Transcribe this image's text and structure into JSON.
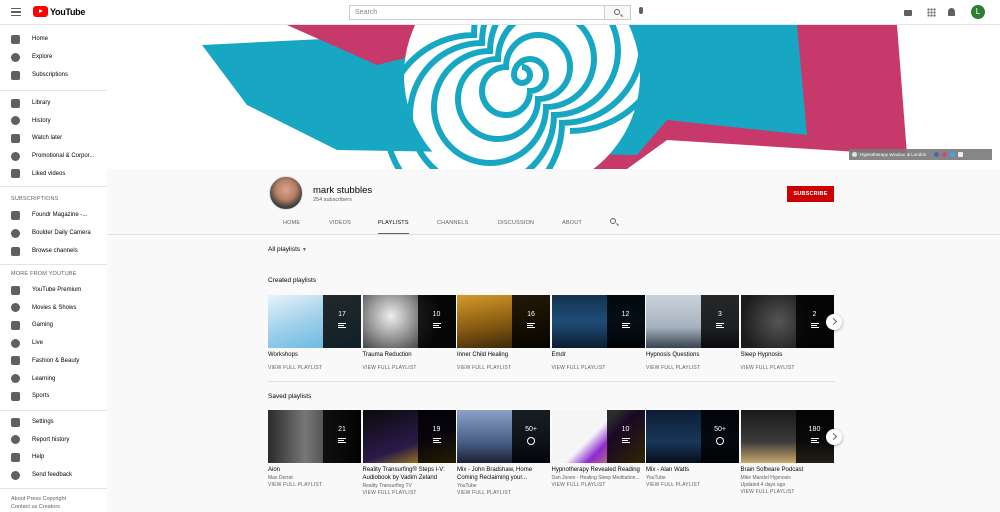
{
  "header": {
    "logo_text": "YouTube",
    "search_placeholder": "Search",
    "avatar_letter": "L"
  },
  "sidebar": {
    "main": [
      {
        "label": "Home",
        "icon": "home-icon"
      },
      {
        "label": "Explore",
        "icon": "compass-icon"
      },
      {
        "label": "Subscriptions",
        "icon": "subscriptions-icon"
      }
    ],
    "library": [
      {
        "label": "Library",
        "icon": "library-icon"
      },
      {
        "label": "History",
        "icon": "history-icon"
      },
      {
        "label": "Watch later",
        "icon": "clock-icon"
      },
      {
        "label": "Promotional & Corpor...",
        "icon": "playlist-icon"
      },
      {
        "label": "Liked videos",
        "icon": "thumbs-up-icon"
      }
    ],
    "subscriptions_heading": "SUBSCRIPTIONS",
    "subscriptions": [
      {
        "label": "Foundr Magazine -...",
        "icon": "channel-foundr-icon"
      },
      {
        "label": "Boulder Daily Camera",
        "icon": "channel-boulder-icon"
      },
      {
        "label": "Browse channels",
        "icon": "add-circle-icon"
      }
    ],
    "more_heading": "MORE FROM YOUTUBE",
    "more": [
      {
        "label": "YouTube Premium",
        "icon": "youtube-premium-icon"
      },
      {
        "label": "Movies & Shows",
        "icon": "film-icon"
      },
      {
        "label": "Gaming",
        "icon": "gamepad-icon"
      },
      {
        "label": "Live",
        "icon": "live-icon"
      },
      {
        "label": "Fashion & Beauty",
        "icon": "hanger-icon"
      },
      {
        "label": "Learning",
        "icon": "lightbulb-icon"
      },
      {
        "label": "Sports",
        "icon": "trophy-icon"
      }
    ],
    "settings": [
      {
        "label": "Settings",
        "icon": "gear-icon"
      },
      {
        "label": "Report history",
        "icon": "flag-icon"
      },
      {
        "label": "Help",
        "icon": "help-icon"
      },
      {
        "label": "Send feedback",
        "icon": "feedback-icon"
      }
    ],
    "footer_line1": "About  Press  Copyright",
    "footer_line2": "Contact us  Creators"
  },
  "banner": {
    "badge_text": "Hypnotherapy Windsor & London"
  },
  "channel": {
    "name": "mark stubbles",
    "subscribers": "254 subscribers",
    "subscribe_label": "SUBSCRIBE",
    "tabs": [
      "HOME",
      "VIDEOS",
      "PLAYLISTS",
      "CHANNELS",
      "DISCUSSION",
      "ABOUT"
    ],
    "active_tab": "PLAYLISTS"
  },
  "content": {
    "sort_label": "All playlists",
    "created_title": "Created playlists",
    "saved_title": "Saved playlists",
    "view_full": "VIEW FULL PLAYLIST",
    "created": [
      {
        "title": "Workshops",
        "count": "17"
      },
      {
        "title": "Trauma Reduction",
        "count": "10"
      },
      {
        "title": "Inner Child Healing",
        "count": "16"
      },
      {
        "title": "Emdr",
        "count": "12"
      },
      {
        "title": "Hypnosis Questions",
        "count": "3"
      },
      {
        "title": "Sleep Hypnosis",
        "count": "2"
      }
    ],
    "saved": [
      {
        "title": "Aion",
        "sub": "Max Derrat",
        "sub2": "",
        "count": "21",
        "live": false
      },
      {
        "title": "Reality Transurfing® Steps I-V: Audiobook by Vadim Zeland",
        "sub": "Reality Transurfing TV",
        "sub2": "",
        "count": "19",
        "live": false
      },
      {
        "title": "Mix - John Bradshaw, Home Coming Reclaiming your...",
        "sub": "YouTube",
        "sub2": "",
        "count": "50+",
        "live": true
      },
      {
        "title": "Hypnotherapy Revealed Reading",
        "sub": "Dan Jones - Healing Sleep Meditation...",
        "sub2": "",
        "count": "10",
        "live": false
      },
      {
        "title": "Mix - Alan Watts",
        "sub": "YouTube",
        "sub2": "",
        "count": "50+",
        "live": true
      },
      {
        "title": "Brain Software Podcast",
        "sub": "Mike Mandel Hypnosis",
        "sub2": "Updated 4 days ago",
        "count": "180",
        "live": false
      }
    ]
  }
}
